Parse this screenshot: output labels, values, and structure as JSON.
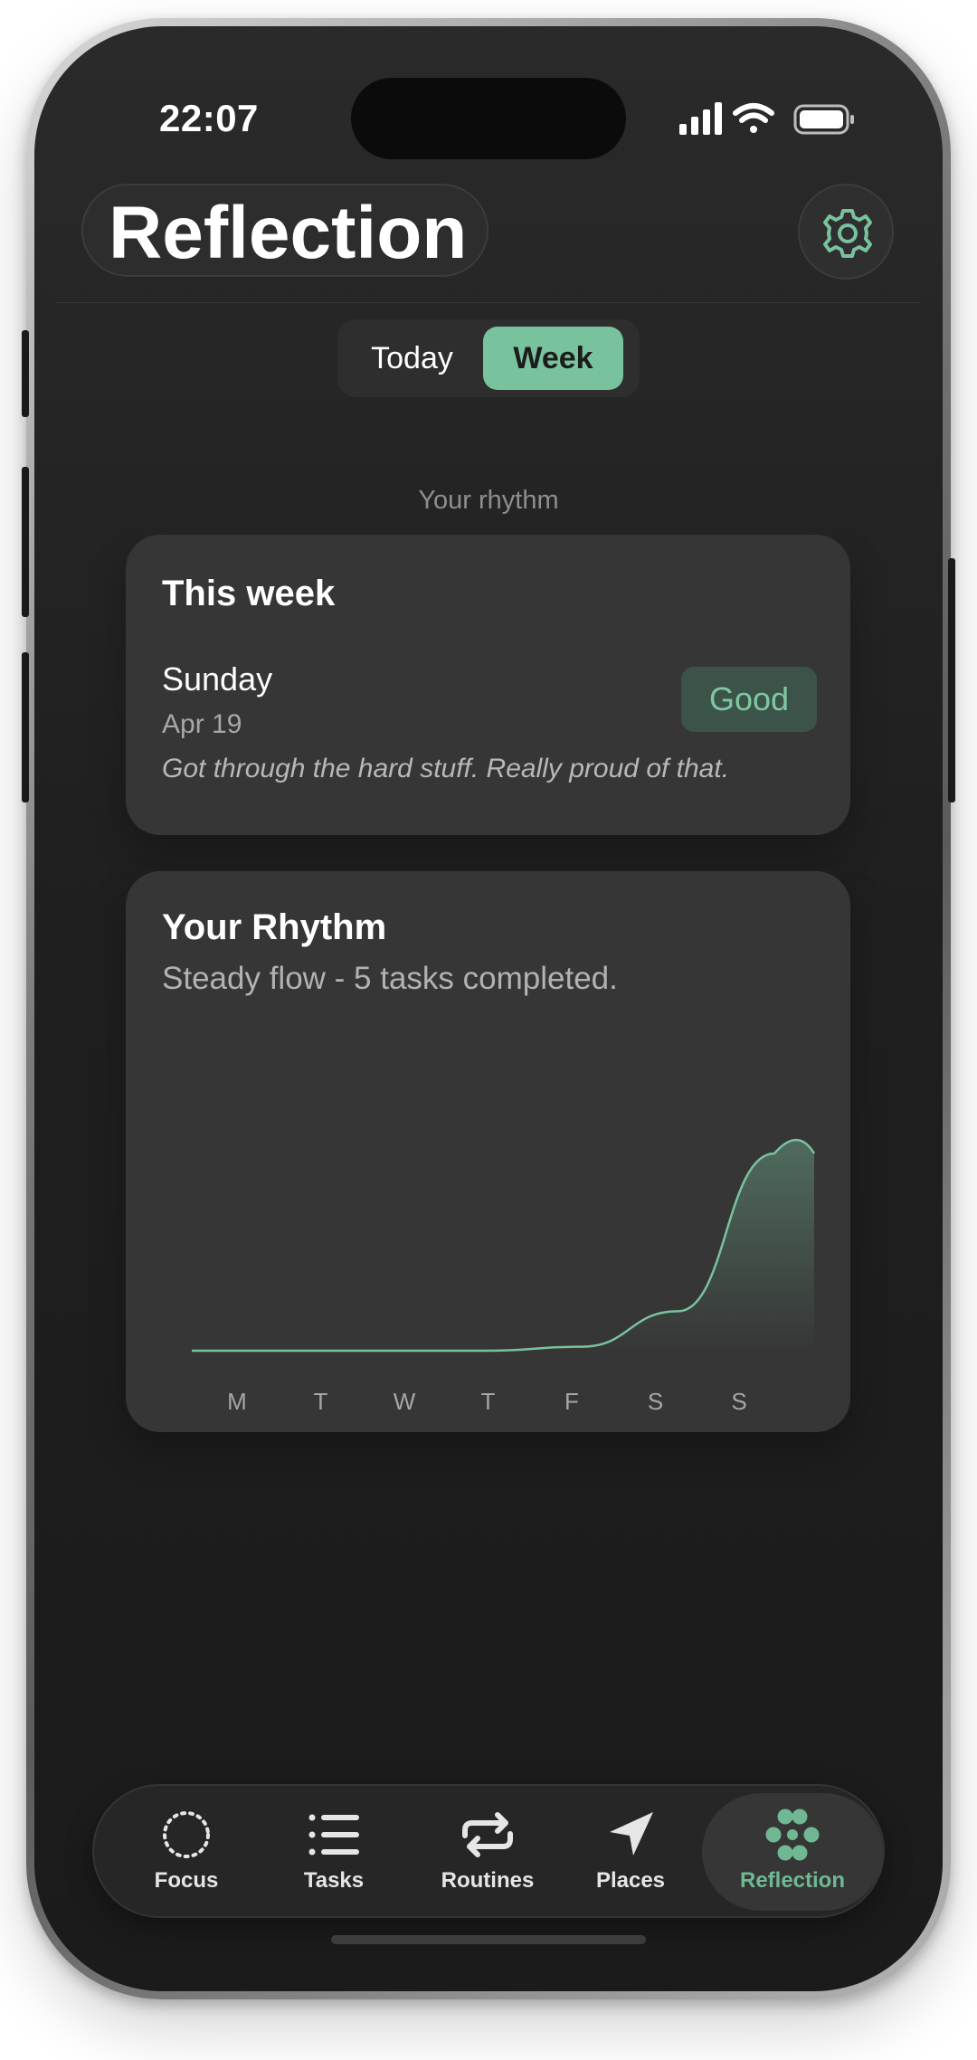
{
  "status_bar": {
    "time": "22:07",
    "icons": [
      "signal-icon",
      "wifi-icon",
      "battery-icon"
    ]
  },
  "header": {
    "title": "Reflection",
    "settings_icon": "gear-icon"
  },
  "segmented": {
    "options": [
      "Today",
      "Week"
    ],
    "selected": "Week"
  },
  "section_label": "Your rhythm",
  "week_card": {
    "title": "This week",
    "entry": {
      "day": "Sunday",
      "date": "Apr 19",
      "note": "Got through the hard stuff. Really proud of that.",
      "mood": "Good"
    }
  },
  "rhythm_card": {
    "title": "Your Rhythm",
    "subtitle": "Steady flow - 5 tasks completed."
  },
  "chart_data": {
    "type": "area",
    "categories": [
      "M",
      "T",
      "W",
      "T",
      "F",
      "S",
      "S"
    ],
    "values": [
      0,
      0,
      0,
      0,
      0.1,
      1,
      5
    ],
    "ylim": [
      0,
      5
    ],
    "grid": false,
    "legend": "none"
  },
  "tabbar": {
    "items": [
      {
        "label": "Focus",
        "icon": "focus-ring-icon"
      },
      {
        "label": "Tasks",
        "icon": "list-icon"
      },
      {
        "label": "Routines",
        "icon": "repeat-icon"
      },
      {
        "label": "Places",
        "icon": "location-arrow-icon"
      },
      {
        "label": "Reflection",
        "icon": "flower-icon"
      }
    ],
    "active": "Reflection"
  },
  "colors": {
    "accent": "#79c29e",
    "background": "#1f1f1f",
    "card": "#363636",
    "mood_badge": "#3c5349"
  }
}
